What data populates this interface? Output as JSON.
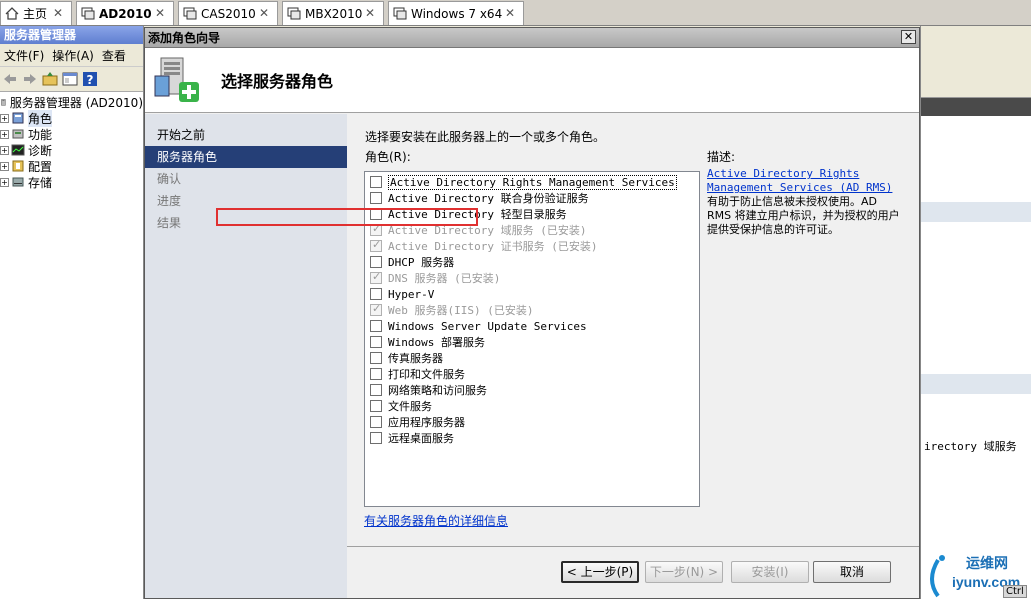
{
  "tabs": [
    {
      "label": "主页",
      "icon": "home-icon",
      "active": false
    },
    {
      "label": "AD2010",
      "icon": "vm-icon",
      "active": true
    },
    {
      "label": "CAS2010",
      "icon": "vm-icon",
      "active": false
    },
    {
      "label": "MBX2010",
      "icon": "vm-icon",
      "active": false
    },
    {
      "label": "Windows 7 x64",
      "icon": "vm-icon",
      "active": false
    }
  ],
  "tab_close_glyph": "✕",
  "background_app": {
    "title": "服务器管理器",
    "menu": [
      "文件(F)",
      "操作(A)",
      "查看"
    ],
    "tree_root": "服务器管理器 (AD2010)",
    "tree_items": [
      "角色",
      "功能",
      "诊断",
      "配置",
      "存储"
    ],
    "right_fragment": "irectory 域服务",
    "ctrl_label": "Ctrl"
  },
  "wizard": {
    "title": "添加角色向导",
    "close_glyph": "✕",
    "header_title": "选择服务器角色",
    "nav": [
      {
        "label": "开始之前",
        "state": "normal"
      },
      {
        "label": "服务器角色",
        "state": "current"
      },
      {
        "label": "确认",
        "state": "dim"
      },
      {
        "label": "进度",
        "state": "dim"
      },
      {
        "label": "结果",
        "state": "dim"
      }
    ],
    "instruction": "选择要安装在此服务器上的一个或多个角色。",
    "roles_label": "角色(R):",
    "roles": [
      {
        "label": "Active Directory Rights Management Services",
        "checked": false,
        "disabled": false,
        "selected": true
      },
      {
        "label": "Active Directory 联合身份验证服务",
        "checked": false,
        "disabled": false,
        "selected": false
      },
      {
        "label": "Active Directory 轻型目录服务",
        "checked": false,
        "disabled": false,
        "selected": false
      },
      {
        "label": "Active Directory 域服务  (已安装)",
        "checked": true,
        "disabled": true,
        "selected": false
      },
      {
        "label": "Active Directory 证书服务  (已安装)",
        "checked": true,
        "disabled": true,
        "selected": false
      },
      {
        "label": "DHCP 服务器",
        "checked": false,
        "disabled": false,
        "selected": false
      },
      {
        "label": "DNS 服务器  (已安装)",
        "checked": true,
        "disabled": true,
        "selected": false
      },
      {
        "label": "Hyper-V",
        "checked": false,
        "disabled": false,
        "selected": false
      },
      {
        "label": "Web 服务器(IIS)  (已安装)",
        "checked": true,
        "disabled": true,
        "selected": false
      },
      {
        "label": "Windows Server Update Services",
        "checked": false,
        "disabled": false,
        "selected": false
      },
      {
        "label": "Windows 部署服务",
        "checked": false,
        "disabled": false,
        "selected": false
      },
      {
        "label": "传真服务器",
        "checked": false,
        "disabled": false,
        "selected": false
      },
      {
        "label": "打印和文件服务",
        "checked": false,
        "disabled": false,
        "selected": false
      },
      {
        "label": "网络策略和访问服务",
        "checked": false,
        "disabled": false,
        "selected": false
      },
      {
        "label": "文件服务",
        "checked": false,
        "disabled": false,
        "selected": false
      },
      {
        "label": "应用程序服务器",
        "checked": false,
        "disabled": false,
        "selected": false
      },
      {
        "label": "远程桌面服务",
        "checked": false,
        "disabled": false,
        "selected": false
      }
    ],
    "description_label": "描述:",
    "description_link": "Active Directory Rights Management Services (AD RMS)",
    "description_text": "有助于防止信息被未授权使用。AD RMS 将建立用户标识，并为授权的用户提供受保护信息的许可证。",
    "more_info_link": "有关服务器角色的详细信息",
    "buttons": {
      "back": "< 上一步(P)",
      "next": "下一步(N) >",
      "install": "安装(I)",
      "cancel": "取消"
    }
  },
  "watermark": {
    "line1": "运维网",
    "line2": "iyunv.com"
  },
  "check_glyph": "✓"
}
